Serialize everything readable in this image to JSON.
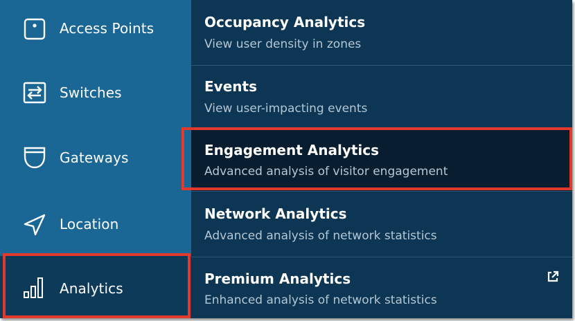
{
  "sidebar": {
    "items": [
      {
        "label": "Access Points",
        "icon": "access-point-icon"
      },
      {
        "label": "Switches",
        "icon": "switch-icon"
      },
      {
        "label": "Gateways",
        "icon": "gateway-icon"
      },
      {
        "label": "Location",
        "icon": "location-icon"
      },
      {
        "label": "Analytics",
        "icon": "analytics-icon",
        "active": true
      }
    ]
  },
  "submenu": {
    "items": [
      {
        "title": "Occupancy Analytics",
        "description": "View user density in zones"
      },
      {
        "title": "Events",
        "description": "View user-impacting events"
      },
      {
        "title": "Engagement Analytics",
        "description": "Advanced analysis of visitor engagement",
        "selected": true
      },
      {
        "title": "Network Analytics",
        "description": "Advanced analysis of network statistics"
      },
      {
        "title": "Premium Analytics",
        "description": "Enhanced analysis of network statistics",
        "external_link_icon": "external-link-icon"
      }
    ]
  },
  "colors": {
    "sidebar_bg": "#1a6796",
    "sidebar_active_bg": "#0e3a5a",
    "submenu_bg": "#0d3654",
    "submenu_selected_bg": "#081d30",
    "highlight_border": "#e3382c"
  }
}
